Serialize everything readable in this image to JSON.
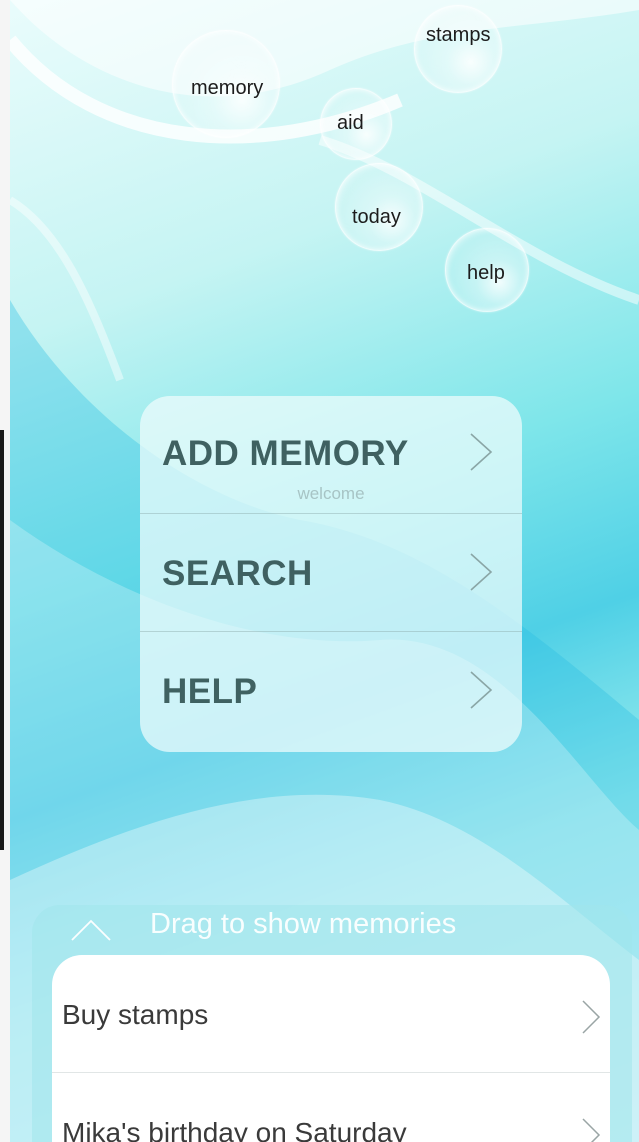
{
  "bubbles": [
    {
      "id": "stamps",
      "label": "stamps"
    },
    {
      "id": "memory",
      "label": "memory"
    },
    {
      "id": "aid",
      "label": "aid"
    },
    {
      "id": "today",
      "label": "today"
    },
    {
      "id": "help",
      "label": "help"
    }
  ],
  "menu": {
    "items": [
      {
        "label": "ADD MEMORY"
      },
      {
        "label": "SEARCH"
      },
      {
        "label": "HELP"
      }
    ],
    "welcome": "welcome"
  },
  "drawer": {
    "hint": "Drag to show memories",
    "memories": [
      {
        "title": "Buy stamps"
      },
      {
        "title": "Mika's birthday on Saturday"
      }
    ]
  },
  "colors": {
    "accent": "#4fd0e6",
    "menu_text": "#3f6161",
    "background_light": "#eafcfc"
  }
}
